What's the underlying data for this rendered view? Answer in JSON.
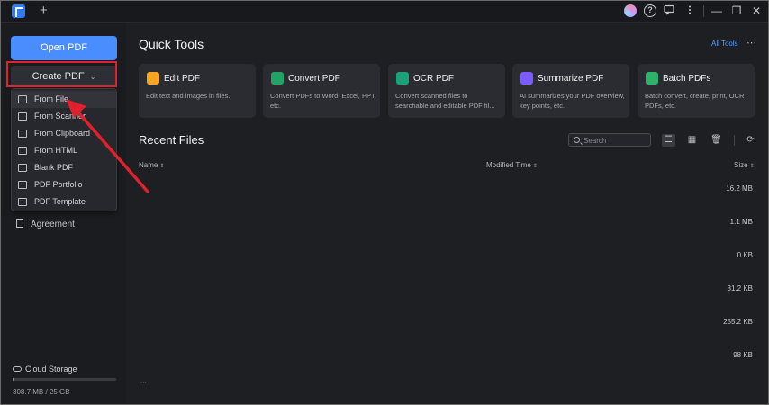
{
  "titlebar": {
    "new_tab": "+",
    "help": "?",
    "minimize": "—",
    "restore": "❐",
    "close": "✕"
  },
  "sidebar": {
    "open_pdf": "Open PDF",
    "create_pdf": "Create PDF",
    "create_menu": [
      {
        "label": "From File",
        "icon": "folder-icon"
      },
      {
        "label": "From Scanner",
        "icon": "scanner-icon"
      },
      {
        "label": "From Clipboard",
        "icon": "clipboard-icon"
      },
      {
        "label": "From HTML",
        "icon": "html-icon"
      },
      {
        "label": "Blank PDF",
        "icon": "blank-pdf-icon"
      },
      {
        "label": "PDF Portfolio",
        "icon": "portfolio-icon"
      },
      {
        "label": "PDF Template",
        "icon": "template-icon"
      }
    ],
    "agreement": "Agreement",
    "cloud_storage": "Cloud Storage",
    "storage_used": "308.7 MB / 25 GB",
    "storage_fraction": 0.012
  },
  "quick_tools": {
    "title": "Quick Tools",
    "all_tools": "All Tools",
    "more": "⋯",
    "cards": [
      {
        "title": "Edit PDF",
        "desc": "Edit text and images in files.",
        "color": "#f5a623"
      },
      {
        "title": "Convert PDF",
        "desc": "Convert PDFs to Word, Excel, PPT, etc.",
        "color": "#21a366"
      },
      {
        "title": "OCR PDF",
        "desc": "Convert scanned files to searchable and editable PDF fil...",
        "color": "#19a37a"
      },
      {
        "title": "Summarize PDF",
        "desc": "AI summarizes your PDF overview, key points, etc.",
        "color": "#7b5cff"
      },
      {
        "title": "Batch PDFs",
        "desc": "Batch convert, create, print, OCR PDFs, etc.",
        "color": "#2fb36b"
      }
    ]
  },
  "recent_files": {
    "title": "Recent Files",
    "search_placeholder": "Search",
    "columns": {
      "name": "Name",
      "modified": "Modified Time",
      "size": "Size"
    },
    "sizes": [
      "16.2 MB",
      "1.1 MB",
      "0 KB",
      "31.2 KB",
      "255.2 KB",
      "98 KB"
    ],
    "ellipsis": "..."
  },
  "colors": {
    "accent": "#4a8dff",
    "highlight": "#e0202a"
  }
}
